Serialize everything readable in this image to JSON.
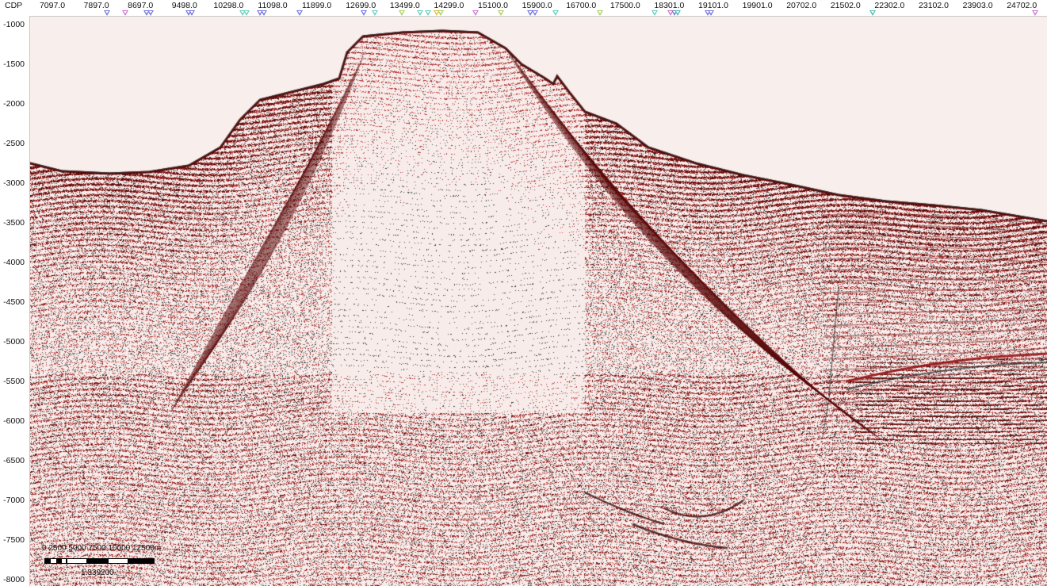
{
  "header": {
    "axis_name": "CDP",
    "cdp_labels": [
      "7097.0",
      "7897.0",
      "8697.0",
      "9498.0",
      "10298.0",
      "11098.0",
      "11899.0",
      "12699.0",
      "13499.0",
      "14299.0",
      "15100.0",
      "15900.0",
      "16700.0",
      "17500.0",
      "18301.0",
      "19101.0",
      "19901.0",
      "20702.0",
      "21502.0",
      "22302.0",
      "23102.0",
      "23903.0",
      "24702.0"
    ]
  },
  "depth_axis": {
    "labels": [
      "-1000",
      "-1500",
      "-2000",
      "-2500",
      "-3000",
      "-3500",
      "-4000",
      "-4500",
      "-5000",
      "-5500",
      "-6000",
      "-6500",
      "-7000",
      "-7500",
      "-8000"
    ]
  },
  "well_markers": {
    "colors": [
      "#7a7ae0",
      "#d07ad0",
      "#6ad0c0",
      "#b0d060",
      "#e0c040",
      "#50c0b0"
    ]
  },
  "scalebar": {
    "distance_labels": "0   2500  5000  7500 10000 12500m",
    "scale_text": "1:339200"
  },
  "colors": {
    "background": "#f8eeec",
    "reflector_dark": "#5a0a0a",
    "reflector_red": "#b83030",
    "reflector_grey": "#2a3a38"
  }
}
